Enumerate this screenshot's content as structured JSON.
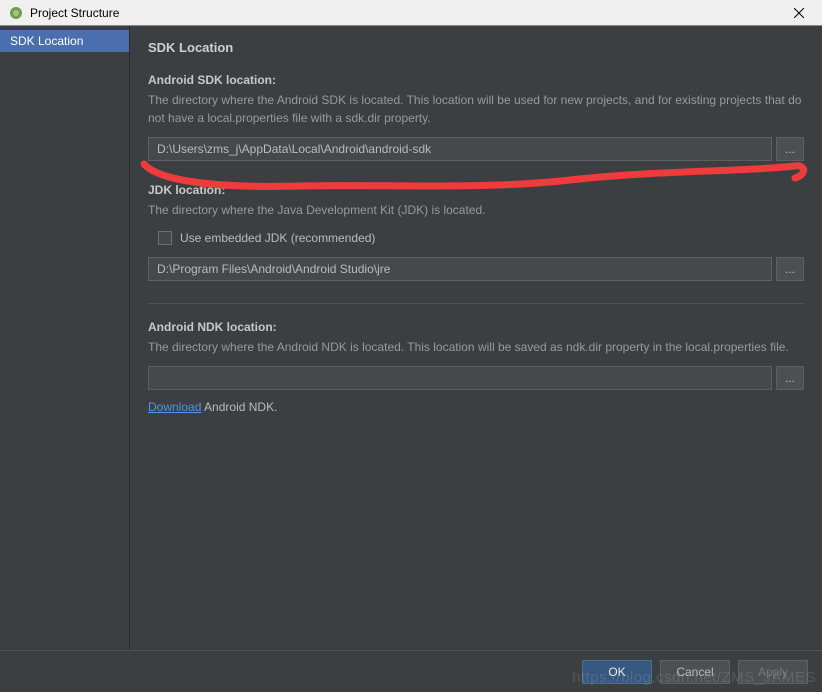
{
  "titlebar": {
    "title": "Project Structure"
  },
  "sidebar": {
    "items": [
      {
        "label": "SDK Location"
      }
    ]
  },
  "content": {
    "heading": "SDK Location",
    "sdk": {
      "label": "Android SDK location:",
      "desc": "The directory where the Android SDK is located. This location will be used for new projects, and for existing projects that do not have a local.properties file with a sdk.dir property.",
      "value": "D:\\Users\\zms_j\\AppData\\Local\\Android\\android-sdk",
      "browse": "..."
    },
    "jdk": {
      "label": "JDK location:",
      "desc": "The directory where the Java Development Kit (JDK) is located.",
      "checkbox_label": "Use embedded JDK (recommended)",
      "value": "D:\\Program Files\\Android\\Android Studio\\jre",
      "browse": "..."
    },
    "ndk": {
      "label": "Android NDK location:",
      "desc": "The directory where the Android NDK is located. This location will be saved as ndk.dir property in the local.properties file.",
      "value": "",
      "browse": "...",
      "download_link": "Download",
      "download_text": " Android NDK."
    }
  },
  "footer": {
    "ok": "OK",
    "cancel": "Cancel",
    "apply": "Apply"
  },
  "watermark": "https://blog.csdn.net/ZMS_JAMES"
}
